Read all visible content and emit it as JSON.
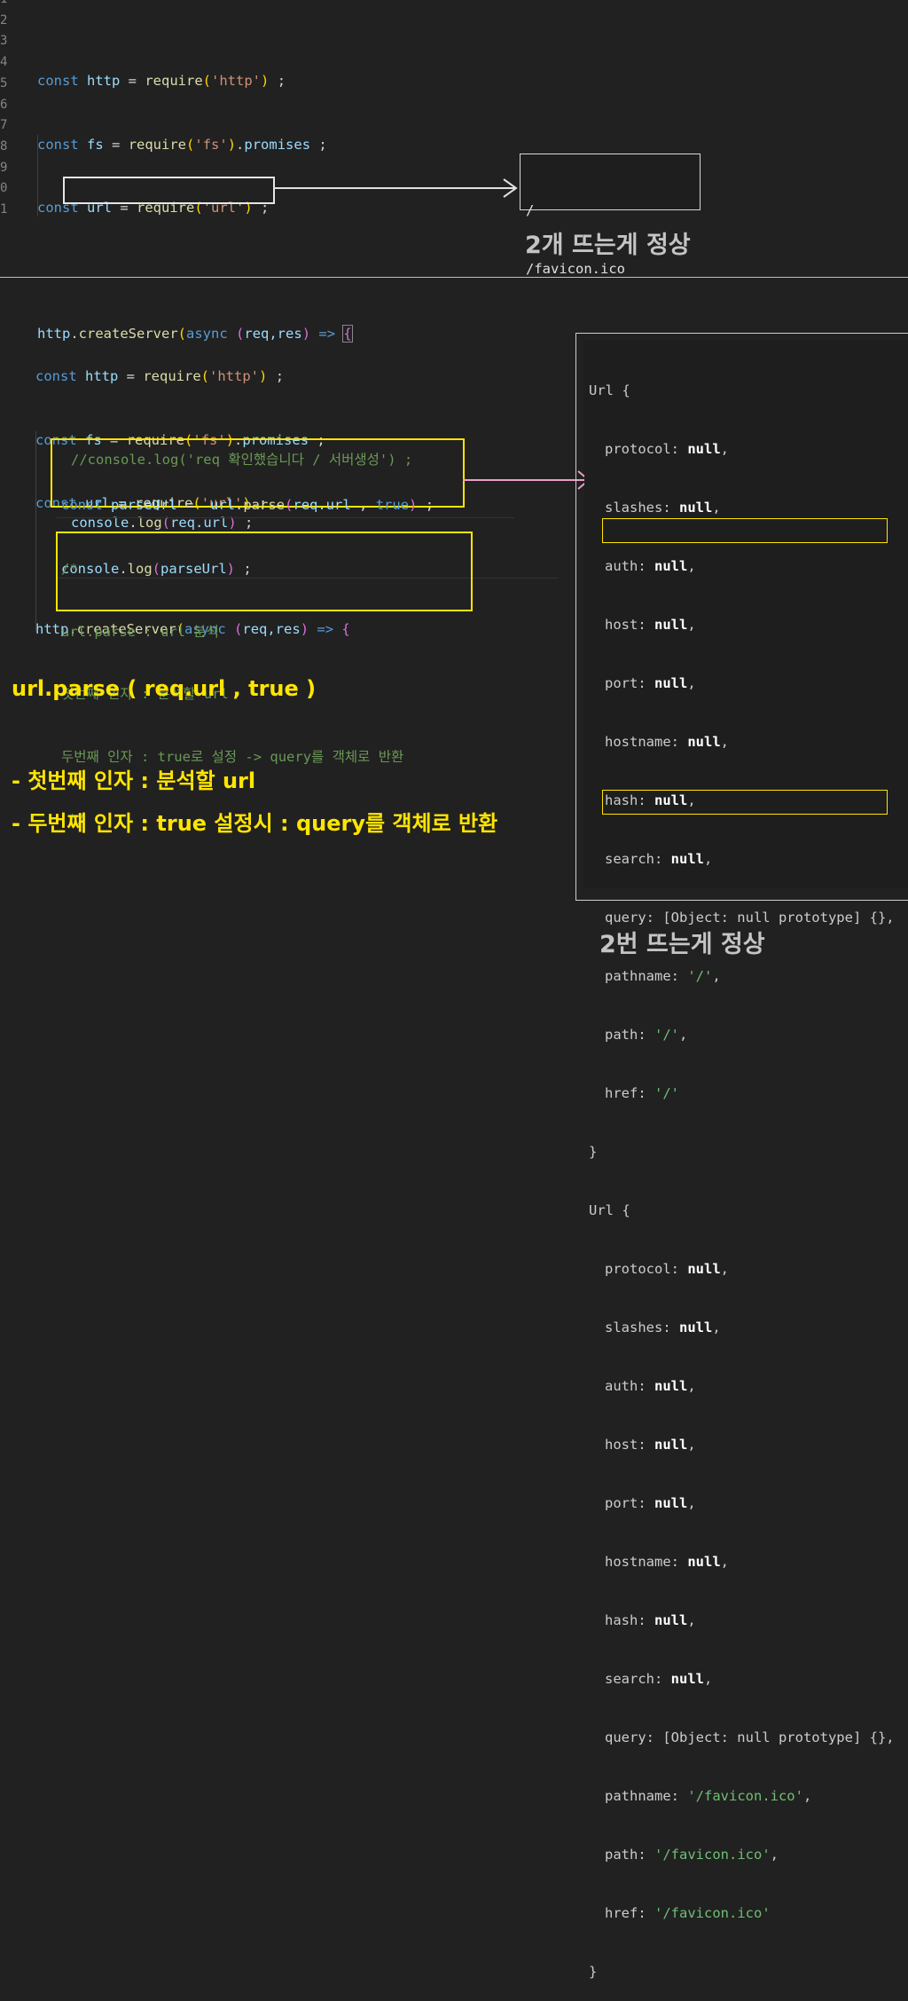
{
  "top": {
    "line_numbers": [
      "1",
      "2",
      "3",
      "4",
      "5",
      "6",
      "7",
      "8",
      "9",
      "0",
      "1"
    ],
    "code": {
      "l3": {
        "kw": "const",
        "var": "http",
        "eq": " = ",
        "fn": "require",
        "p1": "(",
        "str": "'http'",
        "p2": ")",
        "end": " ;"
      },
      "l4": {
        "kw": "const",
        "var": "fs",
        "eq": " = ",
        "fn": "require",
        "p1": "(",
        "str": "'fs'",
        "p2": ")",
        "dot": ".",
        "prop": "promises",
        "end": " ;"
      },
      "l5": {
        "kw": "const",
        "var": "url",
        "eq": " = ",
        "fn": "require",
        "p1": "(",
        "str": "'url'",
        "p2": ")",
        "end": " ;"
      },
      "l7": {
        "obj": "http",
        "dot": ".",
        "fn": "createServer",
        "p1": "(",
        "kw": "async",
        "sp": " ",
        "p2": "(",
        "args": "req,res",
        "p3": ")",
        "arrow": " => ",
        "brace": "{"
      },
      "l9": "//console.log('req 확인했습니다 / 서버생성') ;",
      "l10": {
        "obj": "console",
        "dot": ".",
        "fn": "log",
        "p1": "(",
        "arg": "req.url",
        "p2": ")",
        "end": " ;"
      }
    },
    "output": [
      "/",
      "/favicon.ico"
    ],
    "caption": "2개 뜨는게 정상"
  },
  "bottom": {
    "code": {
      "l1": {
        "kw": "const",
        "var": "http",
        "eq": " = ",
        "fn": "require",
        "p1": "(",
        "str": "'http'",
        "p2": ")",
        "end": " ;"
      },
      "l2": {
        "kw": "const",
        "var": "fs",
        "eq": " = ",
        "fn": "require",
        "p1": "(",
        "str": "'fs'",
        "p2": ")",
        "dot": ".",
        "prop": "promises",
        "end": " ;"
      },
      "l3": {
        "kw": "const",
        "var": "url",
        "eq": " = ",
        "fn": "require",
        "p1": "(",
        "str": "'url'",
        "p2": ")",
        "end": " ;"
      },
      "l5": {
        "obj": "http",
        "dot": ".",
        "fn": "createServer",
        "p1": "(",
        "kw": "async",
        "sp": " ",
        "p2": "(",
        "args": "req,res",
        "p3": ")",
        "arrow": " => ",
        "brace": "{"
      },
      "p1": {
        "kw": "const",
        "var": "parseUrl",
        "eq": " =  ",
        "obj": "url",
        "dot": ".",
        "fn": "parse",
        "p1": "(",
        "arg": "req.url",
        "comma": " , ",
        "bool": "true",
        "p2": ")",
        "end": " ;"
      },
      "p2": {
        "obj": "console",
        "dot": ".",
        "fn": "log",
        "p1": "(",
        "arg": "parseUrl",
        "p2": ")",
        "end": " ;"
      },
      "c_open": "/*",
      "c1": "url.parse : url 분석",
      "c2": "첫번째 인자 : 분석할 url",
      "c3": "두번째 인자 : true로 설정 -> query를 객체로 반환",
      "c_close": "*/"
    },
    "notes": {
      "heading": "url.parse ( req.url , true )",
      "item1": "- 첫번째 인자 : 분석할 url",
      "item2": "- 두번째 인자 : true 설정시 : query를 객체로 반환"
    },
    "terminal": {
      "obj1": {
        "head": "Url {",
        "protocol": "protocol",
        "slashes": "slashes",
        "auth": "auth",
        "host": "host",
        "port": "port",
        "hostname": "hostname",
        "hash": "hash",
        "search": "search",
        "null": "null",
        "query": "query: [Object: null prototype] {},",
        "pathname_key": "pathname",
        "pathname_val": "'/'",
        "path_key": "path",
        "path_val": "'/'",
        "href_key": "href",
        "href_val": "'/'",
        "close": "}"
      },
      "obj2": {
        "head": "Url {",
        "query": "query: [Object: null prototype] {},",
        "pathname_key": "pathname",
        "pathname_val": "'/favicon.ico'",
        "path_key": "path",
        "path_val": "'/favicon.ico'",
        "href_key": "href",
        "href_val": "'/favicon.ico'",
        "close": "}"
      }
    },
    "caption": "2번 뜨는게 정상"
  }
}
